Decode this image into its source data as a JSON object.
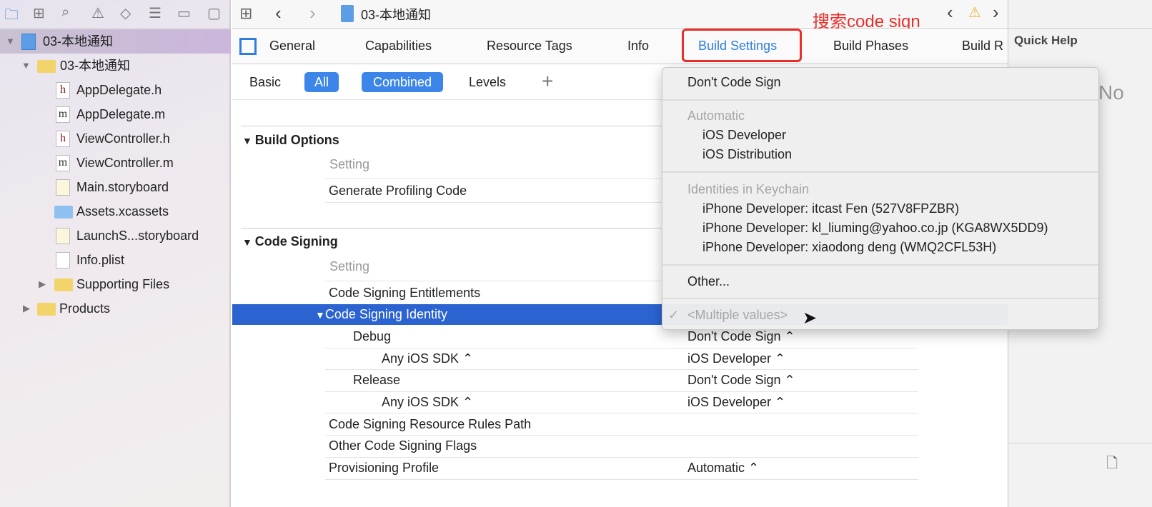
{
  "navigator": {
    "toolbar_icons": [
      "folder-icon",
      "hierarchy-icon",
      "search-icon",
      "warning-icon",
      "breakpoint-icon",
      "list-icon",
      "tag-icon",
      "chat-icon"
    ],
    "project": "03-本地通知",
    "group": "03-本地通知",
    "files": [
      {
        "name": "AppDelegate.h",
        "icon": "h"
      },
      {
        "name": "AppDelegate.m",
        "icon": "m"
      },
      {
        "name": "ViewController.h",
        "icon": "h"
      },
      {
        "name": "ViewController.m",
        "icon": "m"
      },
      {
        "name": "Main.storyboard",
        "icon": "storyboard"
      },
      {
        "name": "Assets.xcassets",
        "icon": "assets"
      },
      {
        "name": "LaunchS...storyboard",
        "icon": "storyboard"
      },
      {
        "name": "Info.plist",
        "icon": "plist"
      }
    ],
    "supporting": "Supporting Files",
    "products": "Products"
  },
  "toolbar": {
    "breadcrumb": "03-本地通知",
    "annotation": "搜索code sign",
    "annotation_color": "#e8302a"
  },
  "tabs": [
    "General",
    "Capabilities",
    "Resource Tags",
    "Info",
    "Build Settings",
    "Build Phases",
    "Build R"
  ],
  "active_tab": "Build Settings",
  "filters": {
    "basic": "Basic",
    "all": "All",
    "combined": "Combined",
    "levels": "Levels",
    "add": "+"
  },
  "sections": {
    "build_options": {
      "title": "Build Options",
      "setting": "Setting",
      "rows": [
        "Generate Profiling Code"
      ]
    },
    "code_signing": {
      "title": "Code Signing",
      "setting": "Setting",
      "entitlements": "Code Signing Entitlements",
      "identity": "Code Signing Identity",
      "debug": "Debug",
      "debug_sdk": "Any iOS SDK ⌃",
      "debug_value": "Don't Code Sign ⌃",
      "debug_sdk_value": "iOS Developer ⌃",
      "release": "Release",
      "release_sdk": "Any iOS SDK ⌃",
      "release_value": "Don't Code Sign ⌃",
      "release_sdk_value": "iOS Developer ⌃",
      "rules_path": "Code Signing Resource Rules Path",
      "other_flags": "Other Code Signing Flags",
      "provisioning": "Provisioning Profile",
      "provisioning_value": "Automatic ⌃"
    }
  },
  "menu": {
    "dont_sign": "Don't Code Sign",
    "automatic": "Automatic",
    "ios_dev": "iOS Developer",
    "ios_dist": "iOS Distribution",
    "keychain": "Identities in Keychain",
    "identities": [
      "iPhone Developer: itcast Fen (527V8FPZBR)",
      "iPhone Developer: kl_liuming@yahoo.co.jp (KGA8WX5DD9)",
      "iPhone Developer: xiaodong deng (WMQ2CFL53H)"
    ],
    "other": "Other...",
    "multiple": "<Multiple values>",
    "check": "✓"
  },
  "quick_help": {
    "title": "Quick Help",
    "partial": "No"
  }
}
